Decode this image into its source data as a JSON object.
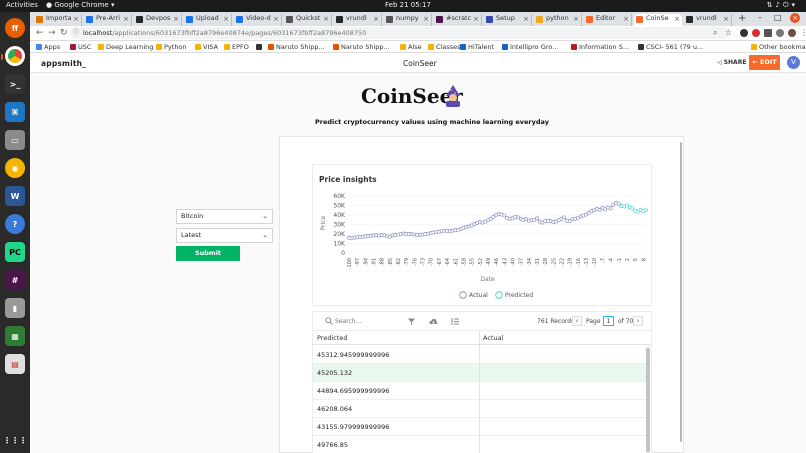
{
  "system": {
    "activities": "Activities",
    "app_name": "Google Chrome",
    "clock": "Feb 21  05:17"
  },
  "browser": {
    "tabs": [
      {
        "label": "Importa",
        "color": "#e37400"
      },
      {
        "label": "Pre-Arri",
        "color": "#1a73e8"
      },
      {
        "label": "Devpos",
        "color": "#24292e"
      },
      {
        "label": "Upload",
        "color": "#1a73e8"
      },
      {
        "label": "Video-d",
        "color": "#1a73e8"
      },
      {
        "label": "Quickst",
        "color": "#555"
      },
      {
        "label": "vrundl",
        "color": "#24292e"
      },
      {
        "label": "numpy",
        "color": "#555"
      },
      {
        "label": "#scratc",
        "color": "#4a154b"
      },
      {
        "label": "Setup",
        "color": "#3949ab"
      },
      {
        "label": "python",
        "color": "#f5a623"
      },
      {
        "label": "Editor",
        "color": "#f86a2b"
      },
      {
        "label": "CoinSe",
        "color": "#f86a2b",
        "active": true
      },
      {
        "label": "vrundl",
        "color": "#24292e"
      }
    ],
    "url_host": "localhost",
    "url_path": "/applications/6031673fbff2a8796e40874e/pages/6031673fbff2a8796e408750",
    "bookmarks": [
      {
        "label": "Apps",
        "color": "#4285f4"
      },
      {
        "label": "USC",
        "color": "#9e1b32"
      },
      {
        "label": "Deep Learning",
        "color": "#f5b400"
      },
      {
        "label": "Python",
        "color": "#f5b400"
      },
      {
        "label": "VISA",
        "color": "#f5b400"
      },
      {
        "label": "EPFO",
        "color": "#f5b400"
      },
      {
        "label": "",
        "color": "#333"
      },
      {
        "label": "Naruto Shipp...",
        "color": "#e65100"
      },
      {
        "label": "Naruto Shipp...",
        "color": "#e65100"
      },
      {
        "label": "Alse",
        "color": "#f5b400"
      },
      {
        "label": "Classes",
        "color": "#f5b400"
      },
      {
        "label": "HiTalent",
        "color": "#1565c0"
      },
      {
        "label": "Intellipro Gro...",
        "color": "#1565c0"
      },
      {
        "label": "Information S...",
        "color": "#b71c1c"
      },
      {
        "label": "CSCI- 561 (79 u...",
        "color": "#333"
      }
    ],
    "other_bookmarks": "Other bookmarks"
  },
  "app": {
    "logo": "appsmith_",
    "title": "CoinSeer",
    "share": "SHARE",
    "edit": "EDIT",
    "avatar_initial": "V"
  },
  "page": {
    "heading": "CoinSeer",
    "subtitle": "Predict cryptocurrency values using machine learning everyday",
    "coin_select": "Bitcoin",
    "period_select": "Latest",
    "submit": "Submit"
  },
  "chart_data": {
    "type": "line",
    "title": "Price insights",
    "xlabel": "Date",
    "ylabel": "Price",
    "ylim": [
      0,
      60000
    ],
    "yticks": [
      "0",
      "10K",
      "20K",
      "30K",
      "40K",
      "50K",
      "60K"
    ],
    "xticks": [
      "-100",
      "-97",
      "-94",
      "-91",
      "-88",
      "-85",
      "-82",
      "-79",
      "-76",
      "-73",
      "-70",
      "-67",
      "-64",
      "-61",
      "-58",
      "-55",
      "-52",
      "-49",
      "-46",
      "-43",
      "-40",
      "-37",
      "-34",
      "-31",
      "-28",
      "-25",
      "-22",
      "-19",
      "-16",
      "-13",
      "-10",
      "-7",
      "-4",
      "-1",
      "2",
      "5",
      "8"
    ],
    "legend": "bottom-center",
    "series": [
      {
        "name": "Actual",
        "color": "#7a86b8",
        "x": [
          -100,
          -99,
          -98,
          -97,
          -96,
          -95,
          -94,
          -93,
          -92,
          -91,
          -90,
          -89,
          -88,
          -87,
          -86,
          -85,
          -84,
          -83,
          -82,
          -81,
          -80,
          -79,
          -78,
          -77,
          -76,
          -75,
          -74,
          -73,
          -72,
          -71,
          -70,
          -69,
          -68,
          -67,
          -66,
          -65,
          -64,
          -63,
          -62,
          -61,
          -60,
          -59,
          -58,
          -57,
          -56,
          -55,
          -54,
          -53,
          -52,
          -51,
          -50,
          -49,
          -48,
          -47,
          -46,
          -45,
          -44,
          -43,
          -42,
          -41,
          -40,
          -39,
          -38,
          -37,
          -36,
          -35,
          -34,
          -33,
          -32,
          -31,
          -30,
          -29,
          -28,
          -27,
          -26,
          -25,
          -24,
          -23,
          -22,
          -21,
          -20,
          -19,
          -18,
          -17,
          -16,
          -15,
          -14,
          -13,
          -12,
          -11,
          -10,
          -9,
          -8,
          -7,
          -6,
          -5,
          -4,
          -3,
          -2,
          -1,
          0
        ],
        "values": [
          16000,
          15800,
          16200,
          16500,
          17000,
          17200,
          17500,
          18000,
          18200,
          18500,
          18800,
          18300,
          18900,
          18600,
          17500,
          17200,
          18500,
          19000,
          19500,
          20000,
          20500,
          20200,
          20000,
          19800,
          19500,
          19000,
          19200,
          19500,
          19800,
          20200,
          21000,
          21500,
          22000,
          22500,
          22800,
          23500,
          23200,
          23000,
          23500,
          24000,
          24500,
          25000,
          26500,
          27500,
          28000,
          29000,
          30500,
          31500,
          32500,
          32000,
          33000,
          34500,
          36000,
          38000,
          40000,
          41000,
          40500,
          39500,
          37000,
          36000,
          36500,
          38000,
          37500,
          36000,
          35000,
          35500,
          34000,
          35000,
          34500,
          36500,
          33000,
          32000,
          33500,
          34000,
          33500,
          32500,
          33000,
          34500,
          36000,
          37500,
          34000,
          33500,
          35500,
          36000,
          37000,
          38500,
          39500,
          40500,
          42500,
          44000,
          45000,
          46500,
          45500,
          47500,
          46000,
          48000,
          47000,
          51000,
          53000,
          52000,
          49500
        ]
      },
      {
        "name": "Predicted",
        "color": "#3ec9c6",
        "x": [
          0,
          1,
          2,
          3,
          4,
          5,
          6,
          7,
          8,
          9
        ],
        "values": [
          49500,
          49000,
          50000,
          48000,
          47000,
          44500,
          43500,
          45500,
          44000,
          45000
        ]
      }
    ]
  },
  "table": {
    "search_placeholder": "Search...",
    "records": "761 Records",
    "page_label": "Page",
    "page_current": "1",
    "page_total": "of 70",
    "columns": [
      "Predicted",
      "Actual"
    ],
    "rows": [
      {
        "predicted": "45312.945999999996",
        "actual": ""
      },
      {
        "predicted": "45205.132",
        "actual": "",
        "selected": true
      },
      {
        "predicted": "44894.695999999996",
        "actual": ""
      },
      {
        "predicted": "46208.064",
        "actual": ""
      },
      {
        "predicted": "43155.979999999996",
        "actual": ""
      },
      {
        "predicted": "49766.85",
        "actual": ""
      }
    ]
  }
}
